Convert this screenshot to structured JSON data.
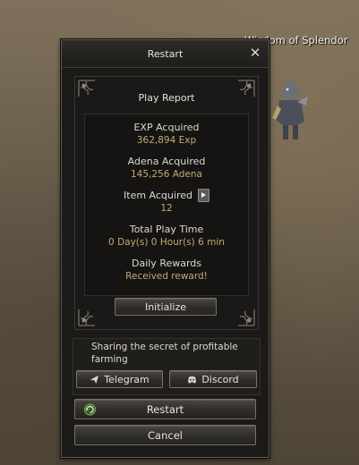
{
  "world": {
    "npc_name": "Wisdom of Splendor"
  },
  "window": {
    "title": "Restart"
  },
  "report": {
    "title": "Play Report",
    "exp_label": "EXP Acquired",
    "exp_value": "362,894 Exp",
    "adena_label": "Adena Acquired",
    "adena_value": "145,256 Adena",
    "item_label": "Item Acquired",
    "item_value": "12",
    "time_label": "Total Play Time",
    "time_value": "0 Day(s) 0 Hour(s) 6 min",
    "daily_label": "Daily Rewards",
    "daily_value": "Received reward!",
    "initialize_label": "Initialize"
  },
  "share": {
    "text": "Sharing the secret of profitable farming",
    "telegram_label": "Telegram",
    "discord_label": "Discord"
  },
  "actions": {
    "restart_label": "Restart",
    "cancel_label": "Cancel"
  },
  "icons": {
    "close": "close-icon",
    "item_arrow": "play-arrow-icon",
    "telegram": "paper-plane-icon",
    "discord": "discord-icon",
    "restart": "restart-icon"
  },
  "colors": {
    "value_gold": "#c4aa72",
    "text": "#ddd9d0",
    "panel": "#1b1a18",
    "button_border": "#77736a"
  }
}
